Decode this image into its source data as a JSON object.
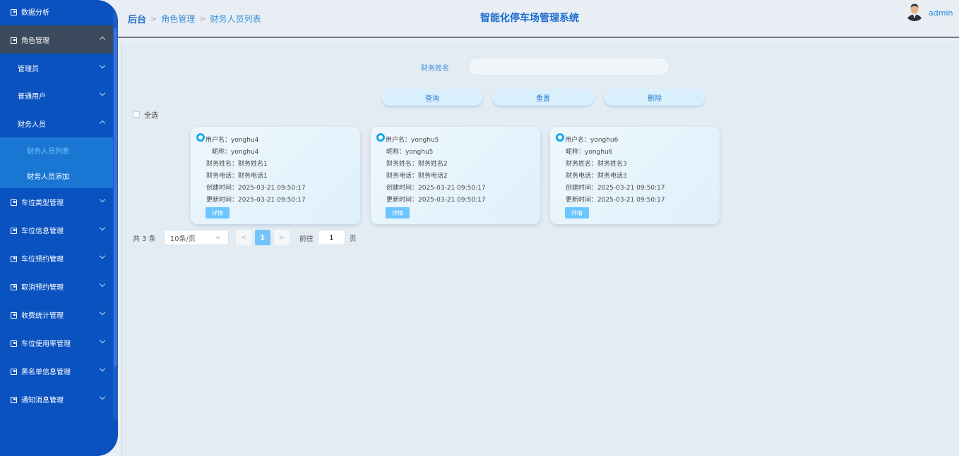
{
  "sidebar": {
    "items": [
      {
        "label": "数据分析",
        "icon": "menu-bullet-icon"
      },
      {
        "label": "角色管理",
        "icon": "menu-bullet-icon",
        "expanded": true
      },
      {
        "label": "车位类型管理",
        "icon": "menu-bullet-icon"
      },
      {
        "label": "车位信息管理",
        "icon": "menu-bullet-icon"
      },
      {
        "label": "车位预约管理",
        "icon": "menu-bullet-icon"
      },
      {
        "label": "取消预约管理",
        "icon": "menu-bullet-icon"
      },
      {
        "label": "收费统计管理",
        "icon": "menu-bullet-icon"
      },
      {
        "label": "车位使用率管理",
        "icon": "menu-bullet-icon"
      },
      {
        "label": "黑名单信息管理",
        "icon": "menu-bullet-icon"
      },
      {
        "label": "通知消息管理",
        "icon": "menu-bullet-icon"
      }
    ],
    "role_sub": [
      {
        "label": "管理员"
      },
      {
        "label": "普通用户"
      },
      {
        "label": "财务人员",
        "expanded": true
      }
    ],
    "finance_children": [
      {
        "label": "财务人员列表",
        "current": true
      },
      {
        "label": "财务人员添加"
      }
    ]
  },
  "header": {
    "breadcrumb": [
      "后台",
      "角色管理",
      "财务人员列表"
    ],
    "title": "智能化停车场管理系统",
    "user": "admin"
  },
  "search": {
    "label": "财务姓名",
    "value": "",
    "placeholder": ""
  },
  "buttons": {
    "query": "查询",
    "reset": "重置",
    "delete": "删除"
  },
  "select_all": "全选",
  "cards": [
    {
      "username": "用户名：yonghu4",
      "nickname": "昵称：yonghu4",
      "name": "财务姓名：财务姓名1",
      "phone": "财务电话：财务电话1",
      "created": "创建时间：2025-03-21 09:50:17",
      "updated": "更新时间：2025-03-21 09:50:17",
      "detail": "详情"
    },
    {
      "username": "用户名：yonghu5",
      "nickname": "昵称：yonghu5",
      "name": "财务姓名：财务姓名2",
      "phone": "财务电话：财务电话2",
      "created": "创建时间：2025-03-21 09:50:17",
      "updated": "更新时间：2025-03-21 09:50:17",
      "detail": "详情"
    },
    {
      "username": "用户名：yonghu6",
      "nickname": "昵称：yonghu6",
      "name": "财务姓名：财务姓名3",
      "phone": "财务电话：财务电话3",
      "created": "创建时间：2025-03-21 09:50:17",
      "updated": "更新时间：2025-03-21 09:50:17",
      "detail": "详情"
    }
  ],
  "pagination": {
    "total": "共 3 条",
    "page_size": "10条/页",
    "prev": "<",
    "current": "1",
    "next": ">",
    "goto_label": "前往",
    "goto_value": "1",
    "page_suffix": "页"
  },
  "colors": {
    "sidebar_bg": "#0a52c0",
    "active_group_bg": "#3b4a5c",
    "submenu_bg": "#1976d2",
    "accent": "#1e88e5",
    "current_page": "#74c4fb"
  }
}
